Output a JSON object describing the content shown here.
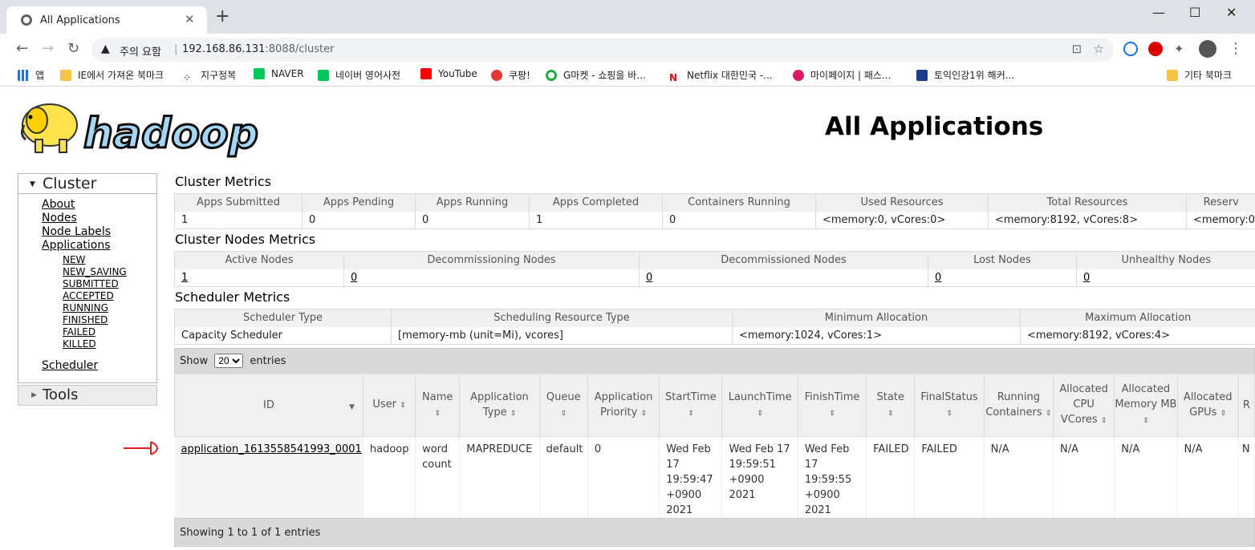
{
  "browser": {
    "tab_title": "All Applications",
    "security_warning": "주의 요함",
    "url_host": "192.168.86.131",
    "url_path": ":8088/cluster",
    "bookmarks": [
      "앱",
      "IE에서 가져온 북마크",
      "지구정복",
      "NAVER",
      "네이버 영어사전",
      "YouTube",
      "쿠팡!",
      "G마켓 - 쇼핑을 바...",
      "Netflix 대한민국 -...",
      "마이페이지 | 패스...",
      "토익인강1위 해커...",
      "기타 북마크"
    ]
  },
  "header": {
    "title": "All Applications",
    "logo_text": "hadoop"
  },
  "nav": {
    "cluster_label": "Cluster",
    "links": [
      "About",
      "Nodes",
      "Node Labels",
      "Applications"
    ],
    "app_states": [
      "NEW",
      "NEW_SAVING",
      "SUBMITTED",
      "ACCEPTED",
      "RUNNING",
      "FINISHED",
      "FAILED",
      "KILLED"
    ],
    "scheduler": "Scheduler",
    "tools_label": "Tools"
  },
  "cluster_metrics": {
    "title": "Cluster Metrics",
    "headers": [
      "Apps Submitted",
      "Apps Pending",
      "Apps Running",
      "Apps Completed",
      "Containers Running",
      "Used Resources",
      "Total Resources",
      "Reserv"
    ],
    "values": [
      "1",
      "0",
      "0",
      "1",
      "0",
      "<memory:0, vCores:0>",
      "<memory:8192, vCores:8>",
      "<memory:0"
    ]
  },
  "nodes_metrics": {
    "title": "Cluster Nodes Metrics",
    "headers": [
      "Active Nodes",
      "Decommissioning Nodes",
      "Decommissioned Nodes",
      "Lost Nodes",
      "Unhealthy Nodes"
    ],
    "values": [
      "1",
      "0",
      "0",
      "0",
      "0"
    ]
  },
  "scheduler_metrics": {
    "title": "Scheduler Metrics",
    "headers": [
      "Scheduler Type",
      "Scheduling Resource Type",
      "Minimum Allocation",
      "Maximum Allocation"
    ],
    "values": [
      "Capacity Scheduler",
      "[memory-mb (unit=Mi), vcores]",
      "<memory:1024, vCores:1>",
      "<memory:8192, vCores:4>"
    ]
  },
  "apps": {
    "show_label": "Show",
    "entries_label": "entries",
    "page_size": "20",
    "columns": [
      "ID",
      "User",
      "Name",
      "Application Type",
      "Queue",
      "Application Priority",
      "StartTime",
      "LaunchTime",
      "FinishTime",
      "State",
      "FinalStatus",
      "Running Containers",
      "Allocated CPU VCores",
      "Allocated Memory MB",
      "Allocated GPUs",
      "R"
    ],
    "rows": [
      [
        "application_1613558541993_0001",
        "hadoop",
        "word count",
        "MAPREDUCE",
        "default",
        "0",
        "Wed Feb 17 19:59:47 +0900 2021",
        "Wed Feb 17 19:59:51 +0900 2021",
        "Wed Feb 17 19:59:55 +0900 2021",
        "FAILED",
        "FAILED",
        "N/A",
        "N/A",
        "N/A",
        "N/A",
        "N"
      ]
    ],
    "footer": "Showing 1 to 1 of 1 entries"
  }
}
